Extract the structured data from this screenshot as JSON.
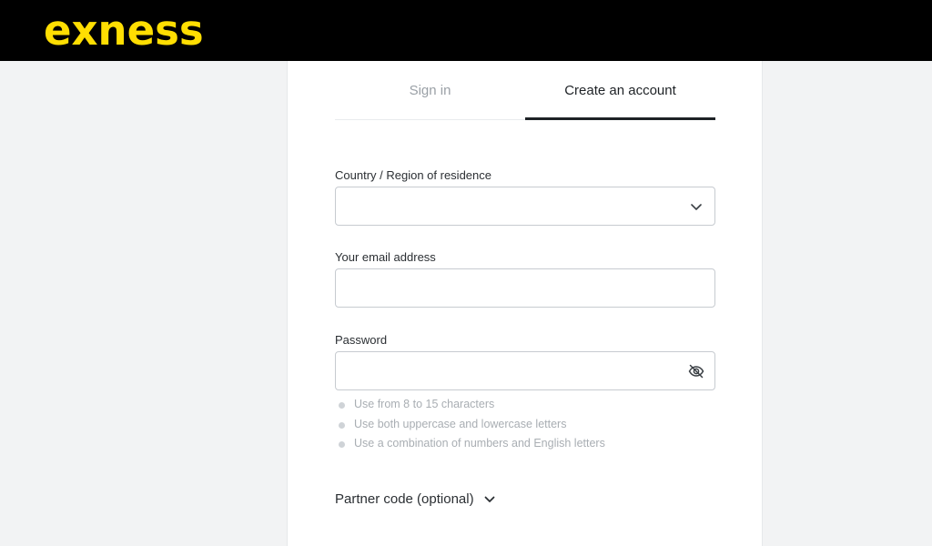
{
  "brand": {
    "logo_text": "exness",
    "logo_color": "#ffde02"
  },
  "tabs": [
    {
      "label": "Sign in",
      "active": false
    },
    {
      "label": "Create an account",
      "active": true
    }
  ],
  "form": {
    "country": {
      "label": "Country / Region of residence",
      "value": "",
      "icon": "chevron-down-icon"
    },
    "email": {
      "label": "Your email address",
      "value": ""
    },
    "password": {
      "label": "Password",
      "value": "",
      "icon": "eye-off-icon"
    },
    "rules": [
      "Use from 8 to 15 characters",
      "Use both uppercase and lowercase letters",
      "Use a combination of numbers and English letters"
    ],
    "partner_code": {
      "label": "Partner code (optional)",
      "icon": "chevron-down-icon"
    }
  }
}
